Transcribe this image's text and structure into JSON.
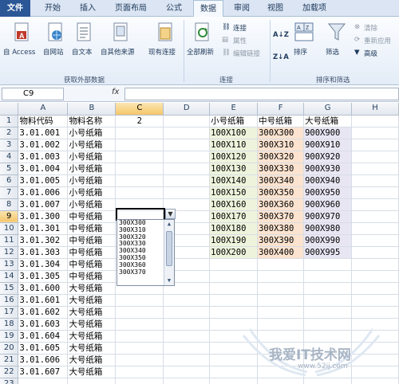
{
  "tabs": [
    {
      "label": "文件",
      "kind": "file"
    },
    {
      "label": "开始"
    },
    {
      "label": "插入"
    },
    {
      "label": "页面布局"
    },
    {
      "label": "公式"
    },
    {
      "label": "数据",
      "kind": "active"
    },
    {
      "label": "审阅"
    },
    {
      "label": "视图"
    },
    {
      "label": "加载项"
    }
  ],
  "ribbon": {
    "from_access": "自 Access",
    "from_web": "自网站",
    "from_text": "自文本",
    "from_other": "自其他来源",
    "existing": "现有连接",
    "group_external": "获取外部数据",
    "refresh_all": "全部刷新",
    "connections": "连接",
    "properties": "属性",
    "edit_links": "编辑链接",
    "group_connections": "连接",
    "sort": "排序",
    "filter": "筛选",
    "clear": "清除",
    "reapply": "重新应用",
    "advanced": "高级",
    "group_sortfilter": "排序和筛选"
  },
  "formula_bar": {
    "name_box": "C9",
    "fx": "fx",
    "formula": ""
  },
  "columns": [
    "A",
    "B",
    "C",
    "D",
    "E",
    "F",
    "G",
    "H"
  ],
  "rows": [
    {
      "n": "1",
      "a": "物料代码",
      "b": "物料名称",
      "c": "2",
      "e": "小号纸箱",
      "f": "中号纸箱",
      "g": "大号纸箱"
    },
    {
      "n": "2",
      "a": "3.01.001",
      "b": "小号纸箱",
      "e": "100X100",
      "f": "300X300",
      "g": "900X900"
    },
    {
      "n": "3",
      "a": "3.01.002",
      "b": "小号纸箱",
      "e": "100X110",
      "f": "300X310",
      "g": "900X910"
    },
    {
      "n": "4",
      "a": "3.01.003",
      "b": "小号纸箱",
      "e": "100X120",
      "f": "300X320",
      "g": "900X920"
    },
    {
      "n": "5",
      "a": "3.01.004",
      "b": "小号纸箱",
      "e": "100X130",
      "f": "300X330",
      "g": "900X930"
    },
    {
      "n": "6",
      "a": "3.01.005",
      "b": "小号纸箱",
      "e": "100X140",
      "f": "300X340",
      "g": "900X940"
    },
    {
      "n": "7",
      "a": "3.01.006",
      "b": "小号纸箱",
      "e": "100X150",
      "f": "300X350",
      "g": "900X950"
    },
    {
      "n": "8",
      "a": "3.01.007",
      "b": "小号纸箱",
      "e": "100X160",
      "f": "300X360",
      "g": "900X960"
    },
    {
      "n": "9",
      "a": "3.01.300",
      "b": "中号纸箱",
      "e": "100X170",
      "f": "300X370",
      "g": "900X970"
    },
    {
      "n": "10",
      "a": "3.01.301",
      "b": "中号纸箱",
      "e": "100X180",
      "f": "300X380",
      "g": "900X980"
    },
    {
      "n": "11",
      "a": "3.01.302",
      "b": "中号纸箱",
      "e": "100X190",
      "f": "300X390",
      "g": "900X990"
    },
    {
      "n": "12",
      "a": "3.01.303",
      "b": "中号纸箱",
      "e": "100X200",
      "f": "300X400",
      "g": "900X995"
    },
    {
      "n": "13",
      "a": "3.01.304",
      "b": "中号纸箱"
    },
    {
      "n": "14",
      "a": "3.01.305",
      "b": "中号纸箱"
    },
    {
      "n": "15",
      "a": "3.01.600",
      "b": "大号纸箱"
    },
    {
      "n": "16",
      "a": "3.01.601",
      "b": "大号纸箱"
    },
    {
      "n": "17",
      "a": "3.01.602",
      "b": "大号纸箱"
    },
    {
      "n": "18",
      "a": "3.01.603",
      "b": "大号纸箱"
    },
    {
      "n": "19",
      "a": "3.01.604",
      "b": "大号纸箱"
    },
    {
      "n": "20",
      "a": "3.01.605",
      "b": "大号纸箱"
    },
    {
      "n": "21",
      "a": "3.01.606",
      "b": "大号纸箱"
    },
    {
      "n": "22",
      "a": "3.01.607",
      "b": "大号纸箱"
    },
    {
      "n": "23",
      "a": "",
      "b": ""
    }
  ],
  "dropdown": {
    "options": [
      "300X300",
      "300X310",
      "300X320",
      "300X330",
      "300X340",
      "300X350",
      "300X360",
      "300X370"
    ]
  },
  "watermark": {
    "text": "我爱IT技术网",
    "url": "www.52ij.com"
  }
}
